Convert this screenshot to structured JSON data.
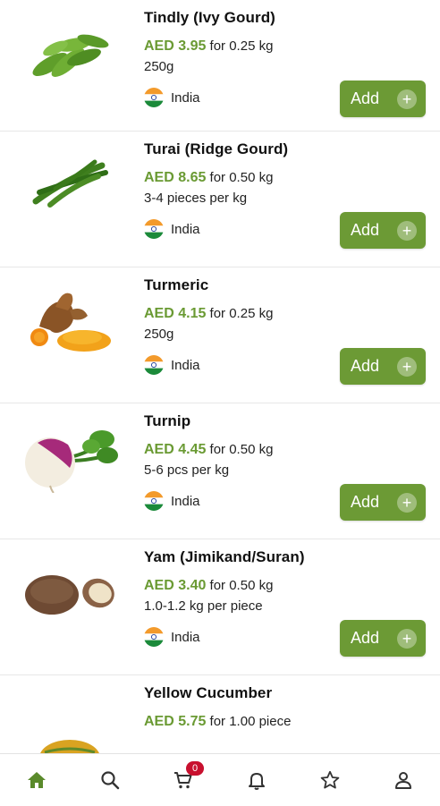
{
  "products": [
    {
      "name": "Tindly (Ivy Gourd)",
      "price": "AED 3.95",
      "unit": "for 0.25 kg",
      "note": "250g",
      "origin": "India",
      "add_label": "Add",
      "image": "ivy-gourd-image"
    },
    {
      "name": "Turai (Ridge Gourd)",
      "price": "AED 8.65",
      "unit": "for 0.50 kg",
      "note": "3-4 pieces per kg",
      "origin": "India",
      "add_label": "Add",
      "image": "ridge-gourd-image"
    },
    {
      "name": "Turmeric",
      "price": "AED 4.15",
      "unit": "for 0.25 kg",
      "note": "250g",
      "origin": "India",
      "add_label": "Add",
      "image": "turmeric-image"
    },
    {
      "name": "Turnip",
      "price": "AED 4.45",
      "unit": "for 0.50 kg",
      "note": "5-6 pcs per kg",
      "origin": "India",
      "add_label": "Add",
      "image": "turnip-image"
    },
    {
      "name": "Yam (Jimikand/Suran)",
      "price": "AED 3.40",
      "unit": "for 0.50 kg",
      "note": "1.0-1.2 kg per piece",
      "origin": "India",
      "add_label": "Add",
      "image": "yam-image"
    },
    {
      "name": "Yellow Cucumber",
      "price": "AED 5.75",
      "unit": "for 1.00 piece",
      "image": "yellow-cucumber-image"
    }
  ],
  "bottom_nav": {
    "items": [
      {
        "icon": "home-icon",
        "active": true
      },
      {
        "icon": "search-icon",
        "active": false
      },
      {
        "icon": "cart-icon",
        "active": false,
        "badge": "0"
      },
      {
        "icon": "bell-icon",
        "active": false
      },
      {
        "icon": "star-icon",
        "active": false
      },
      {
        "icon": "profile-icon",
        "active": false
      }
    ]
  },
  "colors": {
    "accent": "#6c9a35",
    "price": "#6a9a33",
    "badge": "#c8102e",
    "nav_active": "#5a8a2b",
    "nav_inactive": "#333333"
  }
}
